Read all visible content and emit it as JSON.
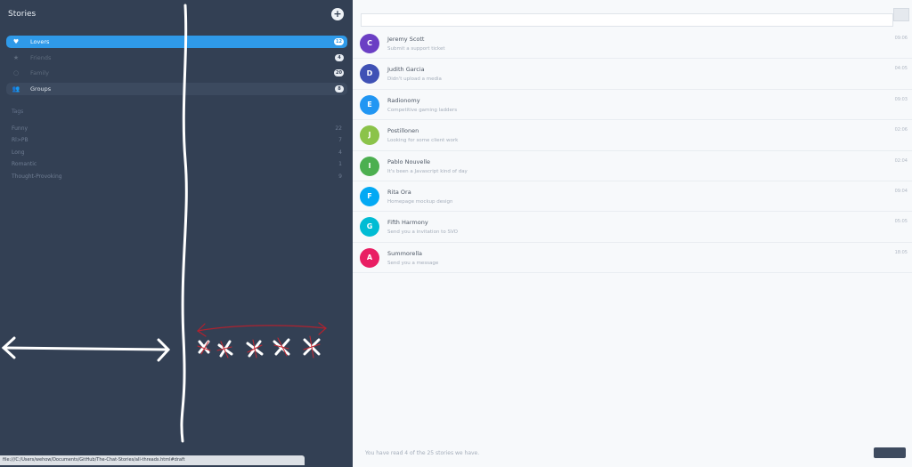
{
  "sidebar": {
    "title": "Stories",
    "add_icon": "plus-icon",
    "groups": [
      {
        "label": "Lovers",
        "count": "12",
        "icon": "heart-icon",
        "glyph": "♥",
        "state": "active"
      },
      {
        "label": "Friends",
        "count": "4",
        "icon": "star-icon",
        "glyph": "★",
        "state": "muted"
      },
      {
        "label": "Family",
        "count": "20",
        "icon": "circle-icon",
        "glyph": "○",
        "state": "muted"
      },
      {
        "label": "Groups",
        "count": "8",
        "icon": "group-icon",
        "glyph": "👥",
        "state": "hovered"
      }
    ],
    "tags_heading": "Tags",
    "tags": [
      {
        "label": "Funny",
        "count": "22"
      },
      {
        "label": "Rl>PB",
        "count": "7"
      },
      {
        "label": "Long",
        "count": "4"
      },
      {
        "label": "Romantic",
        "count": "1"
      },
      {
        "label": "Thought-Provoking",
        "count": "9"
      }
    ]
  },
  "statusbar": {
    "url": "file:///C:/Users/wehow/Documents/GitHub/The-Chat-Stories/all-threads.html#draft"
  },
  "search": {
    "placeholder": "",
    "value": ""
  },
  "stories": [
    {
      "initial": "C",
      "color": "#6b3fc4",
      "name": "Jeremy Scott",
      "message": "Submit a support ticket",
      "time": "09:06"
    },
    {
      "initial": "D",
      "color": "#3f51b5",
      "name": "Judith Garcia",
      "message": "Didn't upload a media",
      "time": "04:05"
    },
    {
      "initial": "E",
      "color": "#2196f3",
      "name": "Radionomy",
      "message": "Competitive gaming ladders",
      "time": "09:03"
    },
    {
      "initial": "J",
      "color": "#8bc34a",
      "name": "Postillonen",
      "message": "Looking for some client work",
      "time": "02:06"
    },
    {
      "initial": "I",
      "color": "#4caf50",
      "name": "Pablo Nouvelle",
      "message": "It's been a Javascript kind of day",
      "time": "02:04"
    },
    {
      "initial": "F",
      "color": "#03a9f4",
      "name": "Rita Ora",
      "message": "Homepage mockup design",
      "time": "09:04"
    },
    {
      "initial": "G",
      "color": "#00bcd4",
      "name": "Fifth Harmony",
      "message": "Send you a invitation to SVO",
      "time": "05:05"
    },
    {
      "initial": "A",
      "color": "#e91e63",
      "name": "Summorella",
      "message": "Send you a message",
      "time": "18:05"
    }
  ],
  "footer": {
    "summary": "You have read 4 of the 25 stories we have."
  }
}
